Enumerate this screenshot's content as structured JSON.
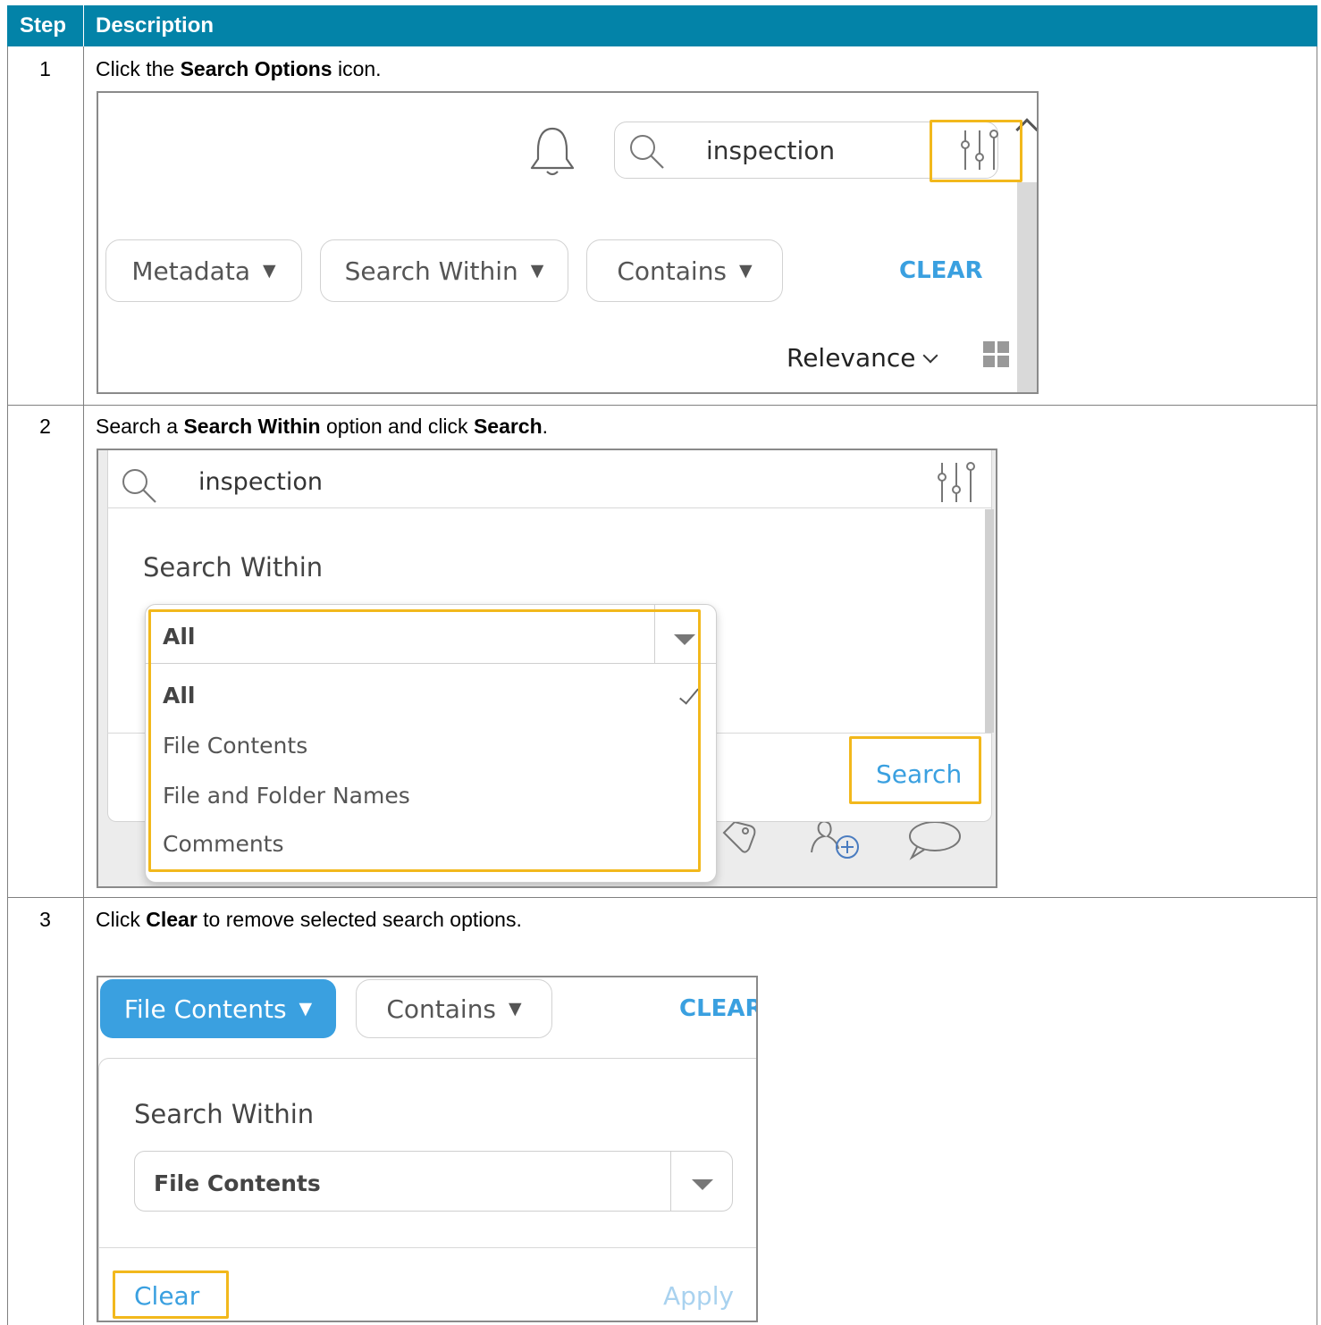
{
  "table": {
    "col_step": "Step",
    "col_description": "Description"
  },
  "steps": [
    {
      "number": "1",
      "parts": [
        "Click the ",
        "Search Options",
        " icon."
      ],
      "ui": {
        "search_value": "inspection",
        "filters": [
          "Metadata",
          "Search Within",
          "Contains"
        ],
        "clear": "CLEAR",
        "sort": "Relevance"
      }
    },
    {
      "number": "2",
      "parts": [
        "Search a ",
        "Search Within",
        " option and click ",
        "Search",
        "."
      ],
      "ui": {
        "search_value": "inspection",
        "section_title": "Search Within",
        "selected": "All",
        "options": [
          "All",
          "File Contents",
          "File and Folder Names",
          "Comments"
        ],
        "search_button": "Search"
      }
    },
    {
      "number": "3",
      "parts": [
        "Click ",
        "Clear",
        " to remove selected search options."
      ],
      "ui": {
        "active_filter": "File Contents",
        "filter2": "Contains",
        "clear_top": "CLEAR",
        "section_title": "Search Within",
        "selected": "File Contents",
        "clear_button": "Clear",
        "apply_button": "Apply"
      }
    }
  ],
  "colors": {
    "header_bg": "#0383a8",
    "highlight": "#f2b81c",
    "link": "#3aa0e0",
    "active_chip": "#3aa0e0"
  }
}
